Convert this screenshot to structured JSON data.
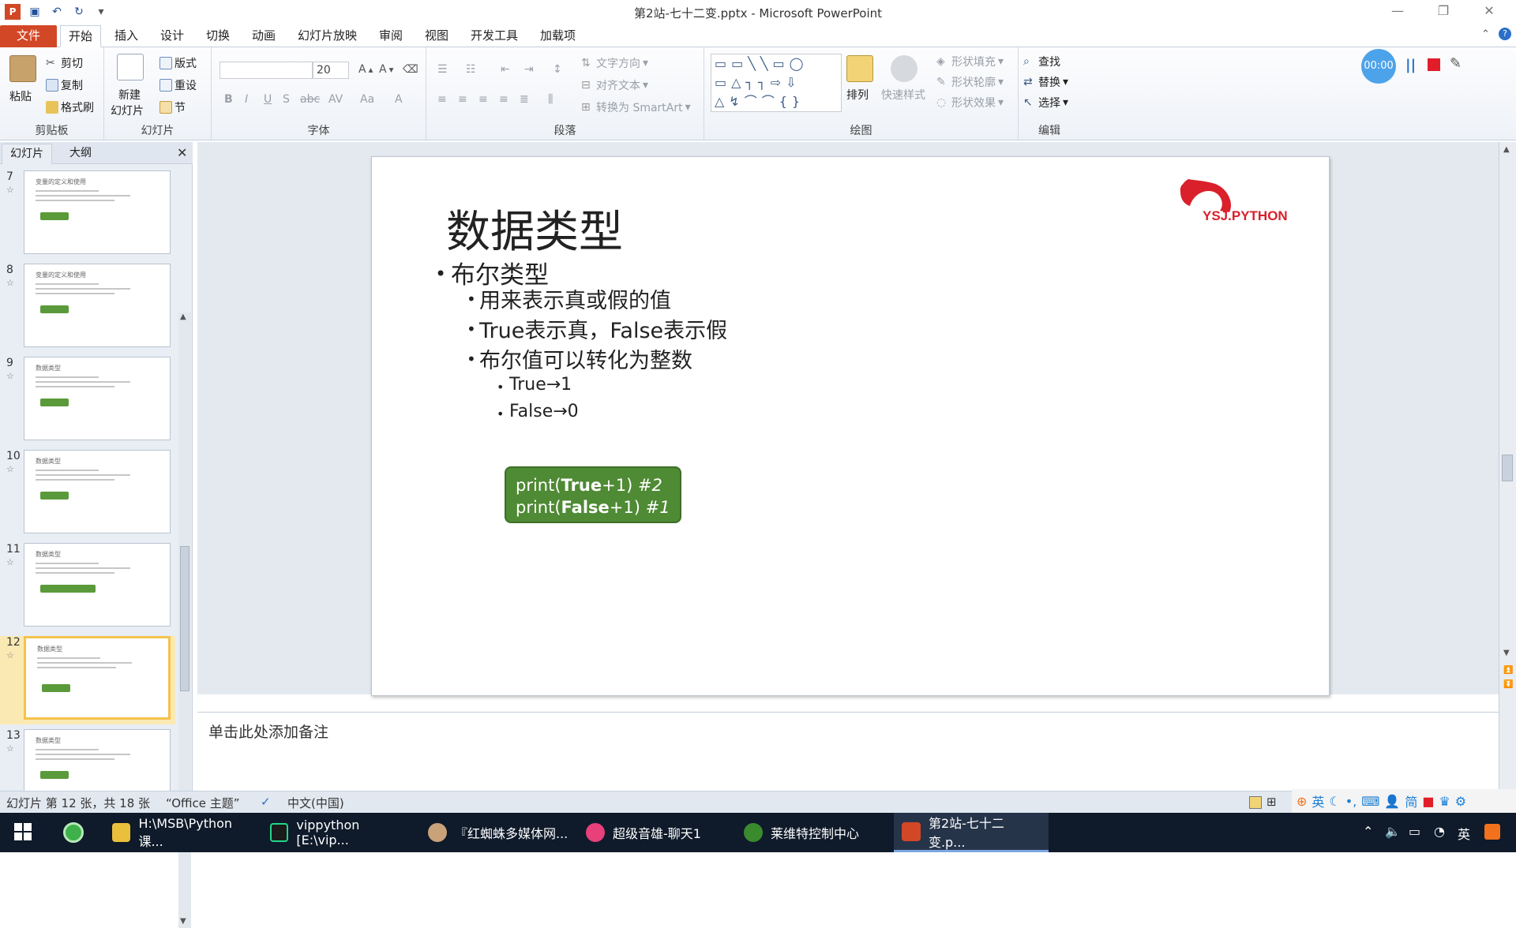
{
  "window": {
    "title": "第2站-七十二变.pptx - Microsoft PowerPoint",
    "minimize_icon": "minimize-icon",
    "maximize_icon": "restore-icon",
    "close_icon": "close-icon"
  },
  "tabs": [
    "文件",
    "开始",
    "插入",
    "设计",
    "切换",
    "动画",
    "幻灯片放映",
    "审阅",
    "视图",
    "开发工具",
    "加载项"
  ],
  "active_tab": "开始",
  "ribbon": {
    "clipboard": {
      "label": "剪贴板",
      "paste": "粘贴",
      "cut": "剪切",
      "copy": "复制",
      "format_painter": "格式刷"
    },
    "slides": {
      "label": "幻灯片",
      "new_slide_1": "新建",
      "new_slide_2": "幻灯片",
      "layout": "版式",
      "reset": "重设",
      "section": "节"
    },
    "font": {
      "label": "字体",
      "font_size": "20"
    },
    "paragraph": {
      "label": "段落",
      "text_direction": "文字方向",
      "align_text": "对齐文本",
      "smartart": "转换为 SmartArt"
    },
    "drawing": {
      "label": "绘图",
      "arrange": "排列",
      "quick_styles": "快速样式",
      "shape_fill": "形状填充",
      "shape_outline": "形状轮廓",
      "shape_effects": "形状效果"
    },
    "editing": {
      "label": "编辑",
      "find": "查找",
      "replace": "替换",
      "select": "选择"
    }
  },
  "recorder": {
    "time": "00:00"
  },
  "left_pane": {
    "tab_slides": "幻灯片",
    "tab_outline": "大纲",
    "thumbnails": [
      {
        "num": "7",
        "title": "变量的定义和使用"
      },
      {
        "num": "8",
        "title": "变量的定义和使用"
      },
      {
        "num": "9",
        "title": "数据类型"
      },
      {
        "num": "10",
        "title": "数据类型"
      },
      {
        "num": "11",
        "title": "数据类型"
      },
      {
        "num": "12",
        "title": "数据类型"
      },
      {
        "num": "13",
        "title": "数据类型"
      }
    ]
  },
  "slide": {
    "title": "数据类型",
    "bullet1": "布尔类型",
    "sub1": "用来表示真或假的值",
    "sub2": "True表示真，False表示假",
    "sub3": "布尔值可以转化为整数",
    "subsub1": "True→1",
    "subsub2": "False→0",
    "code_line1_a": "print(",
    "code_line1_b": "True",
    "code_line1_c": "+1) ",
    "code_line1_d": "#2",
    "code_line2_a": "print(",
    "code_line2_b": "False",
    "code_line2_c": "+1) ",
    "code_line2_d": "#1",
    "logo_text": "YSJ.PYTHON"
  },
  "notes_placeholder": "单击此处添加备注",
  "status": {
    "slide_info": "幻灯片 第 12 张，共 18 张",
    "theme": "“Office 主题”",
    "language": "中文(中国)"
  },
  "taskbar": {
    "items": [
      {
        "label": "H:\\MSB\\Python课..."
      },
      {
        "label": "vippython [E:\\vip..."
      },
      {
        "label": "『红蜘蛛多媒体网..."
      },
      {
        "label": "超级音雄-聊天1"
      },
      {
        "label": "莱维特控制中心"
      },
      {
        "label": "第2站-七十二变.p..."
      }
    ],
    "ime": "英"
  },
  "colors": {
    "file_tab": "#d24726",
    "code_box": "#4f8a34",
    "selected_thumb": "#f5c24a",
    "logo_red": "#d9202b"
  }
}
